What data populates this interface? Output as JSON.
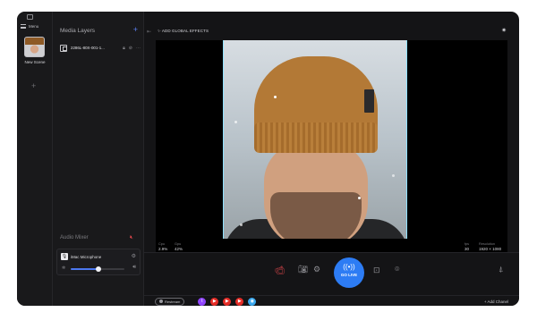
{
  "scenes": {
    "menu_label": "Menu",
    "items": [
      {
        "label": "New Scene"
      }
    ],
    "add_icon": "plus-icon"
  },
  "layers": {
    "title": "Media Layers",
    "add_symbol": "+",
    "items": [
      {
        "label": "2286L-80X-001-1..."
      }
    ]
  },
  "mixer": {
    "title": "Audio Mixer",
    "device": "iMac Microphone",
    "volume_fraction": 0.52
  },
  "stage": {
    "add_effects": "ADD GLOBAL EFFECTS",
    "stats": [
      {
        "label": "Cpu",
        "value": "2.9%"
      },
      {
        "label": "Gpu",
        "value": "42%"
      },
      {
        "label": "fps",
        "value": "30"
      },
      {
        "label": "Resolution",
        "value": "1920 × 1080"
      }
    ]
  },
  "controls": {
    "go_live_label": "GO LIVE"
  },
  "channels": {
    "restream_label": "Restream",
    "add_label": "+ Add Chanel",
    "items": [
      {
        "icon": "twitch-icon",
        "color": "#9146ff"
      },
      {
        "icon": "youtube-icon",
        "color": "#e52d27"
      },
      {
        "icon": "youtube-icon",
        "color": "#e52d27"
      },
      {
        "icon": "youtube-icon",
        "color": "#e52d27"
      },
      {
        "icon": "periscope-icon",
        "color": "#3aa9f0"
      }
    ]
  },
  "colors": {
    "accent": "#2d7cf4",
    "danger": "#e5484d",
    "selection": "#8fe2ff"
  }
}
